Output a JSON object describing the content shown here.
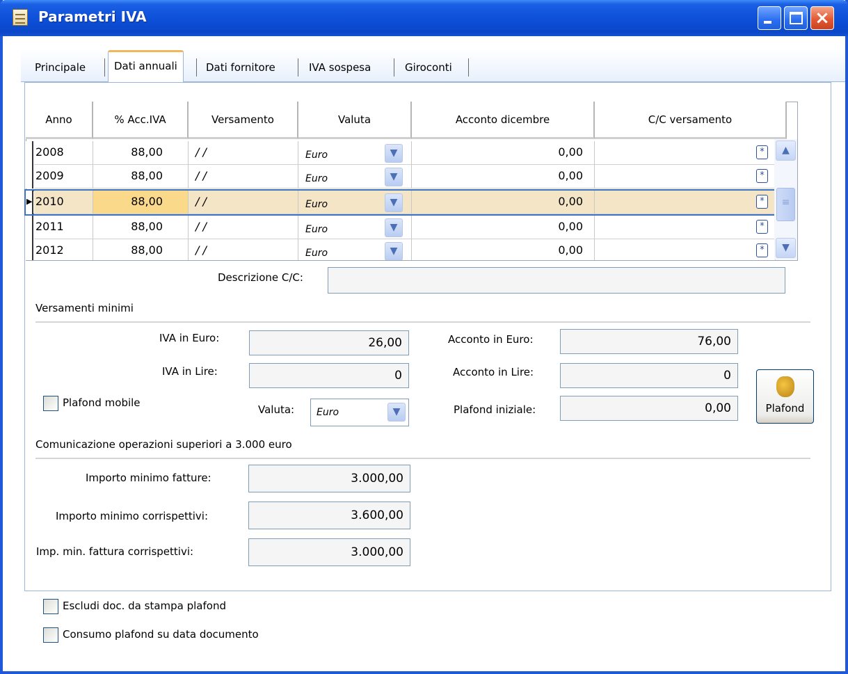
{
  "window": {
    "title": "Parametri IVA"
  },
  "tabs": [
    {
      "label": "Principale"
    },
    {
      "label": "Dati annuali"
    },
    {
      "label": "Dati fornitore"
    },
    {
      "label": "IVA sospesa"
    },
    {
      "label": "Giroconti"
    }
  ],
  "grid": {
    "columns": [
      "Anno",
      "% Acc.IVA",
      "Versamento",
      "Valuta",
      "Acconto dicembre",
      "C/C versamento"
    ],
    "rows": [
      {
        "anno": "2008",
        "acc": "88,00",
        "versamento": "/ /",
        "valuta": "Euro",
        "acconto": "0,00",
        "cc": ""
      },
      {
        "anno": "2009",
        "acc": "88,00",
        "versamento": "/ /",
        "valuta": "Euro",
        "acconto": "0,00",
        "cc": ""
      },
      {
        "anno": "2010",
        "acc": "88,00",
        "versamento": "/ /",
        "valuta": "Euro",
        "acconto": "0,00",
        "cc": ""
      },
      {
        "anno": "2011",
        "acc": "88,00",
        "versamento": "/ /",
        "valuta": "Euro",
        "acconto": "0,00",
        "cc": ""
      },
      {
        "anno": "2012",
        "acc": "88,00",
        "versamento": "/ /",
        "valuta": "Euro",
        "acconto": "0,00",
        "cc": ""
      }
    ]
  },
  "descrizione_cc": {
    "label": "Descrizione C/C:",
    "value": ""
  },
  "versamenti": {
    "section_title": "Versamenti minimi",
    "iva_euro_label": "IVA in Euro:",
    "iva_euro_value": "26,00",
    "iva_lire_label": "IVA in Lire:",
    "iva_lire_value": "0",
    "acconto_euro_label": "Acconto in Euro:",
    "acconto_euro_value": "76,00",
    "acconto_lire_label": "Acconto in Lire:",
    "acconto_lire_value": "0",
    "plafond_mobile_label": "Plafond mobile",
    "valuta_label": "Valuta:",
    "valuta_value": "Euro",
    "plafond_iniziale_label": "Plafond iniziale:",
    "plafond_iniziale_value": "0,00",
    "plafond_button": "Plafond"
  },
  "comunicazione": {
    "section_title": "Comunicazione operazioni superiori a 3.000 euro",
    "fatture_label": "Importo minimo fatture:",
    "fatture_value": "3.000,00",
    "corrispettivi_label": "Importo minimo corrispettivi:",
    "corrispettivi_value": "3.600,00",
    "fattura_corr_label": "Imp. min. fattura corrispettivi:",
    "fattura_corr_value": "3.000,00"
  },
  "options": {
    "escludi_label": "Escludi doc. da stampa plafond",
    "consumo_label": "Consumo plafond su data documento"
  }
}
